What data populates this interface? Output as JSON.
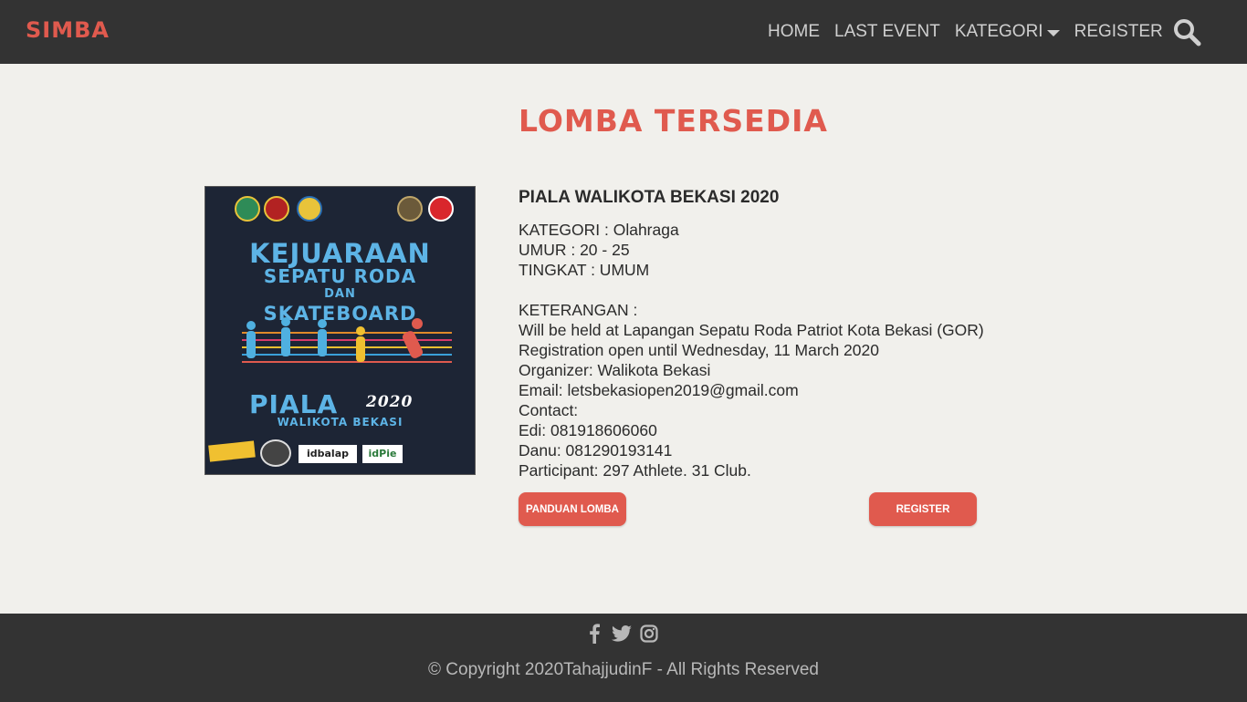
{
  "nav": {
    "brand": "SIMBA",
    "links": [
      "HOME",
      "LAST EVENT",
      "KATEGORI",
      "REGISTER"
    ],
    "search_icon": "search-icon"
  },
  "main": {
    "heading": "LOMBA TERSEDIA",
    "poster": {
      "line1": "KEJUARAAN",
      "line2": "SEPATU RODA",
      "line3": "DAN",
      "line4": "SKATEBOARD",
      "line5": "PIALA",
      "line6": "WALIKOTA BEKASI",
      "year": "2020",
      "sponsor1": "idbalap",
      "sponsor2": "idPie"
    },
    "event": {
      "title": "PIALA WALIKOTA BEKASI 2020",
      "kategori": "KATEGORI : Olahraga",
      "umur": "UMUR : 20 - 25",
      "tingkat": "TINGKAT : UMUM",
      "keterangan_label": "KETERANGAN :",
      "lines": [
        "Will be held at Lapangan Sepatu Roda Patriot Kota Bekasi (GOR)",
        "Registration open until Wednesday, 11 March 2020",
        "Organizer: Walikota Bekasi",
        "Email: letsbekasiopen2019@gmail.com",
        "Contact:",
        "Edi: 081918606060",
        "Danu: 081290193141",
        "Participant: 297 Athlete. 31 Club."
      ]
    },
    "buttons": {
      "panduan": "PANDUAN LOMBA",
      "register": "REGISTER"
    }
  },
  "footer": {
    "social_icons": [
      "facebook-icon",
      "twitter-icon",
      "instagram-icon"
    ],
    "copyright": "© Copyright 2020TahajjudinF - All Rights Reserved"
  },
  "colors": {
    "accent": "#e05a4e",
    "navbar": "#333333",
    "background": "#f1f0ec"
  }
}
